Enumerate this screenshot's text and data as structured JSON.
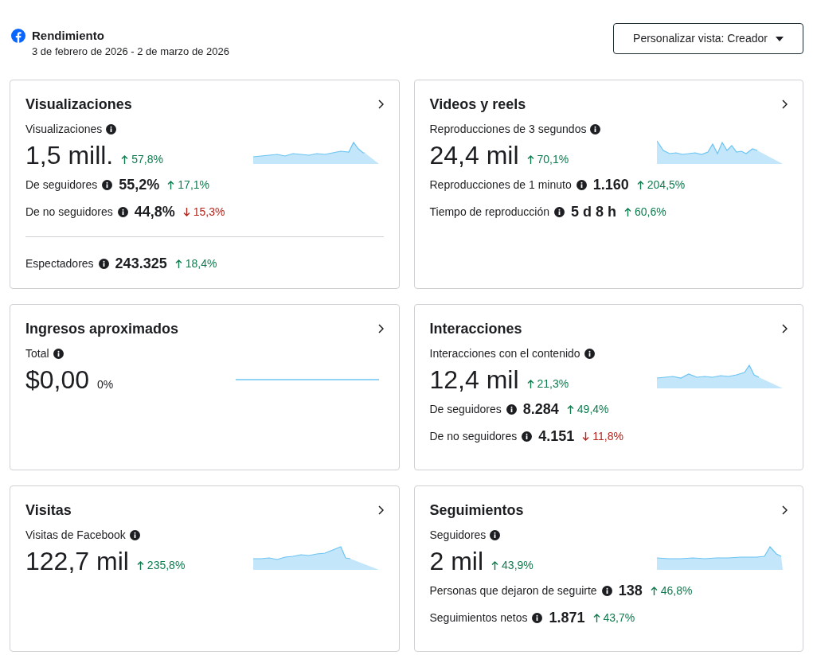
{
  "header": {
    "title": "Rendimiento",
    "date_range": "3 de febrero de 2026 - 2 de marzo de 2026",
    "view_button": "Personalizar vista: Creador"
  },
  "cards": [
    {
      "title": "Visualizaciones",
      "metric": {
        "label": "Visualizaciones",
        "value": "1,5 mill.",
        "change": {
          "text": "57,8%",
          "kind": "up"
        }
      },
      "sparkline": {
        "kind": "area"
      },
      "rows": [
        {
          "label": "De seguidores",
          "value": "55,2%",
          "change": {
            "text": "17,1%",
            "kind": "up"
          },
          "divider_before": false
        },
        {
          "label": "De no seguidores",
          "value": "44,8%",
          "change": {
            "text": "15,3%",
            "kind": "down"
          },
          "divider_before": false
        },
        {
          "label": "Espectadores",
          "value": "243.325",
          "change": {
            "text": "18,4%",
            "kind": "up"
          },
          "divider_before": true
        }
      ]
    },
    {
      "title": "Videos y reels",
      "metric": {
        "label": "Reproducciones de 3 segundos",
        "value": "24,4 mil",
        "change": {
          "text": "70,1%",
          "kind": "up"
        }
      },
      "sparkline": {
        "kind": "area"
      },
      "rows": [
        {
          "label": "Reproducciones de 1 minuto",
          "value": "1.160",
          "change": {
            "text": "204,5%",
            "kind": "up"
          },
          "divider_before": false
        },
        {
          "label": "Tiempo de reproducción",
          "value": "5 d 8 h",
          "change": {
            "text": "60,6%",
            "kind": "up"
          },
          "divider_before": false
        }
      ]
    },
    {
      "title": "Ingresos aproximados",
      "metric": {
        "label": "Total",
        "value": "$0,00",
        "change": {
          "text": "0%",
          "kind": "flat"
        }
      },
      "sparkline": {
        "kind": "flat"
      }
    },
    {
      "title": "Interacciones",
      "metric": {
        "label": "Interacciones con el contenido",
        "value": "12,4 mil",
        "change": {
          "text": "21,3%",
          "kind": "up"
        }
      },
      "sparkline": {
        "kind": "area"
      },
      "rows": [
        {
          "label": "De seguidores",
          "value": "8.284",
          "change": {
            "text": "49,4%",
            "kind": "up"
          },
          "divider_before": false
        },
        {
          "label": "De no seguidores",
          "value": "4.151",
          "change": {
            "text": "11,8%",
            "kind": "down"
          },
          "divider_before": false
        }
      ]
    },
    {
      "title": "Visitas",
      "metric": {
        "label": "Visitas de Facebook",
        "value": "122,7 mil",
        "change": {
          "text": "235,8%",
          "kind": "up"
        }
      },
      "sparkline": {
        "kind": "area"
      }
    },
    {
      "title": "Seguimientos",
      "metric": {
        "label": "Seguidores",
        "value": "2 mil",
        "change": {
          "text": "43,9%",
          "kind": "up"
        }
      },
      "sparkline": {
        "kind": "area"
      },
      "rows": [
        {
          "label": "Personas que dejaron de seguirte",
          "value": "138",
          "change": {
            "text": "46,8%",
            "kind": "up"
          },
          "divider_before": false
        },
        {
          "label": "Seguimientos netos",
          "value": "1.871",
          "change": {
            "text": "43,7%",
            "kind": "up"
          },
          "divider_before": false
        }
      ]
    }
  ]
}
